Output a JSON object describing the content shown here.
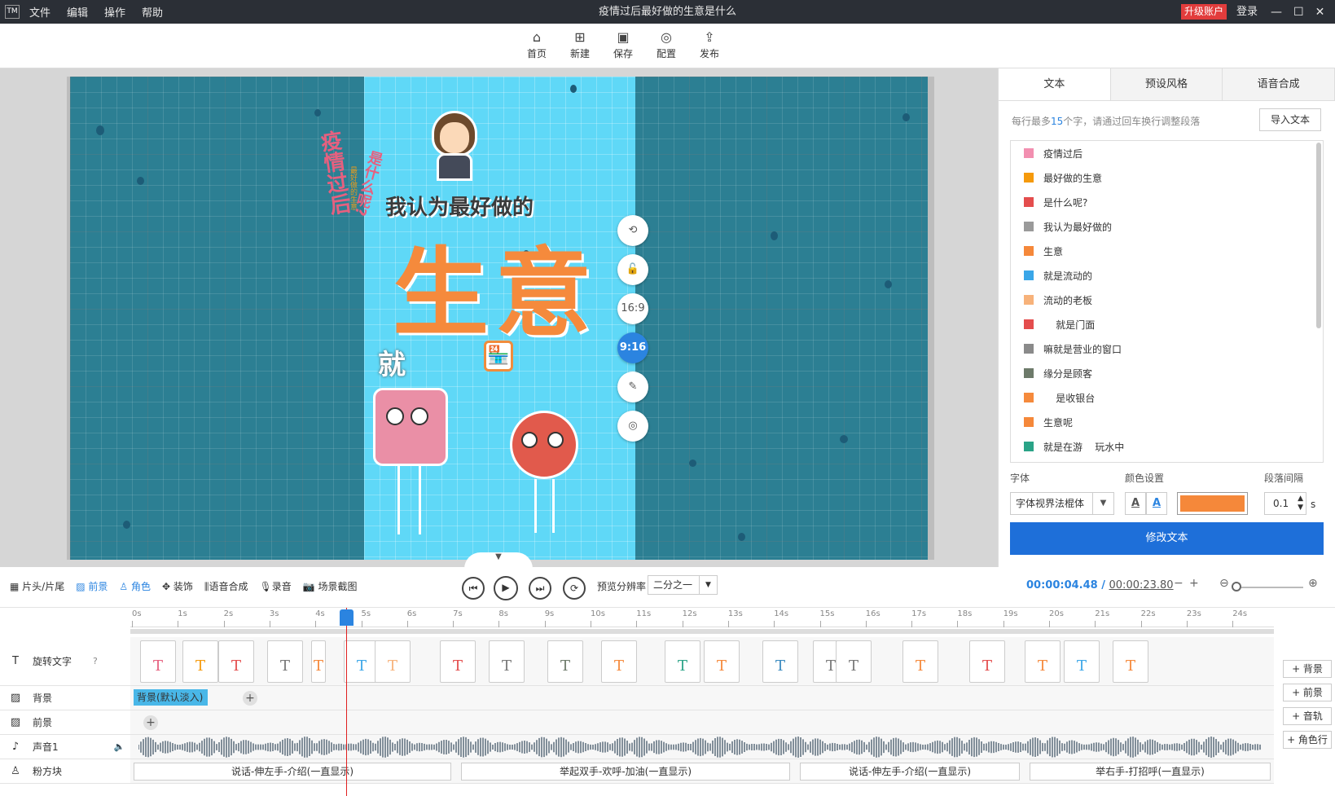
{
  "window": {
    "logo": "TM",
    "menu": [
      "文件",
      "编辑",
      "操作",
      "帮助"
    ],
    "title": "疫情过后最好做的生意是什么",
    "upgrade": "升级账户",
    "login": "登录",
    "controls": [
      "—",
      "☐",
      "✕"
    ]
  },
  "toolbar": [
    {
      "label": "首页",
      "icon": "home-icon",
      "glyph": "⌂"
    },
    {
      "label": "新建",
      "icon": "new-file-icon",
      "glyph": "⊞"
    },
    {
      "label": "保存",
      "icon": "save-icon",
      "glyph": "▣"
    },
    {
      "label": "配置",
      "icon": "settings-icon",
      "glyph": "◎"
    },
    {
      "label": "发布",
      "icon": "publish-icon",
      "glyph": "⇪"
    }
  ],
  "canvas": {
    "vertical_title": "疫情过后",
    "small_text1": "最好做的生意",
    "small_text2": "是什么呢?",
    "headline": "我认为最好做的",
    "big": "生意",
    "jiu": "就",
    "bg_color": "#2c7f93",
    "portrait_color": "#5fd8f7",
    "accent": "#f58a3c"
  },
  "side_tools": [
    {
      "label": "⟲",
      "name": "rotate-tool-button"
    },
    {
      "label": "🔓",
      "name": "unlock-tool-button"
    },
    {
      "label": "16:9",
      "name": "ratio-16-9-button"
    },
    {
      "label": "9:16",
      "name": "ratio-9-16-button",
      "active": true
    },
    {
      "label": "✎",
      "name": "edit-tool-button"
    },
    {
      "label": "◎",
      "name": "settings-tool-button"
    }
  ],
  "right_panel": {
    "tabs": [
      "文本",
      "预设风格",
      "语音合成"
    ],
    "hint_prefix": "每行最多",
    "hint_num": "15",
    "hint_suffix": "个字，请通过回车换行调整段落",
    "import_label": "导入文本",
    "text_items": [
      {
        "text": "疫情过后",
        "color": "#f28fb0"
      },
      {
        "text": "最好做的生意",
        "color": "#f59a0c"
      },
      {
        "text": "是什么呢?",
        "color": "#e44d4d"
      },
      {
        "text": "我认为最好做的",
        "color": "#9a9a9a"
      },
      {
        "text": "生意",
        "color": "#f5883a"
      },
      {
        "text": "就是流动的",
        "color": "#3aa6e8"
      },
      {
        "text": "流动的老板",
        "color": "#f7b27a"
      },
      {
        "text": "    就是门面",
        "color": "#e44d4d"
      },
      {
        "text": "嘛就是营业的窗口",
        "color": "#8a8a8a"
      },
      {
        "text": "缘分是顾客",
        "color": "#6d7a6a"
      },
      {
        "text": "    是收银台",
        "color": "#f58a3c"
      },
      {
        "text": "生意呢",
        "color": "#f5883a"
      },
      {
        "text": "就是在游    玩水中",
        "color": "#2aa387"
      }
    ],
    "font_label": "字体",
    "font_value": "字体视界法棍体",
    "color_label": "颜色设置",
    "color_value": "#f5883a",
    "spacing_label": "段落间隔",
    "spacing_value": "0.1",
    "spacing_unit": "s",
    "modify_label": "修改文本"
  },
  "controls": {
    "tabs": [
      {
        "label": "片头/片尾",
        "icon": "▦",
        "name": "tab-intro-outro"
      },
      {
        "label": "前景",
        "icon": "▨",
        "name": "tab-foreground",
        "on": true
      },
      {
        "label": "角色",
        "icon": "♙",
        "name": "tab-character",
        "on": true
      },
      {
        "label": "装饰",
        "icon": "✥",
        "name": "tab-decoration"
      },
      {
        "label": "语音合成",
        "icon": "⫼",
        "name": "tab-tts"
      },
      {
        "label": "录音",
        "icon": "🎙",
        "name": "tab-record"
      },
      {
        "label": "场景截图",
        "icon": "📷",
        "name": "tab-screenshot"
      }
    ],
    "resolution_label": "预览分辨率",
    "resolution_value": "二分之一",
    "current_time": "00:00:04.48",
    "total_time": "00:00:23.80"
  },
  "timeline": {
    "ticks": [
      "0s",
      "1s",
      "2s",
      "3s",
      "4s",
      "5s",
      "6s",
      "7s",
      "8s",
      "9s",
      "10s",
      "11s",
      "12s",
      "13s",
      "14s",
      "15s",
      "16s",
      "17s",
      "18s",
      "19s",
      "20s",
      "21s",
      "22s",
      "23s",
      "24s"
    ],
    "tracks": [
      {
        "label": "旋转文字",
        "icon": "T"
      },
      {
        "label": "背景",
        "icon": "▨"
      },
      {
        "label": "前景",
        "icon": "▨"
      },
      {
        "label": "声音1",
        "icon": "♪"
      },
      {
        "label": "粉方块",
        "icon": "♙"
      }
    ],
    "bg_clip": "背景(默认淡入)",
    "add_buttons": [
      "+ 背景",
      "+ 前景",
      "+ 音轨",
      "+ 角色行"
    ],
    "action_clips": [
      "说话-伸左手-介绍(一直显示)",
      "举起双手-欢呼-加油(一直显示)",
      "说话-伸左手-介绍(一直显示)",
      "举右手-打招呼(一直显示)"
    ]
  }
}
